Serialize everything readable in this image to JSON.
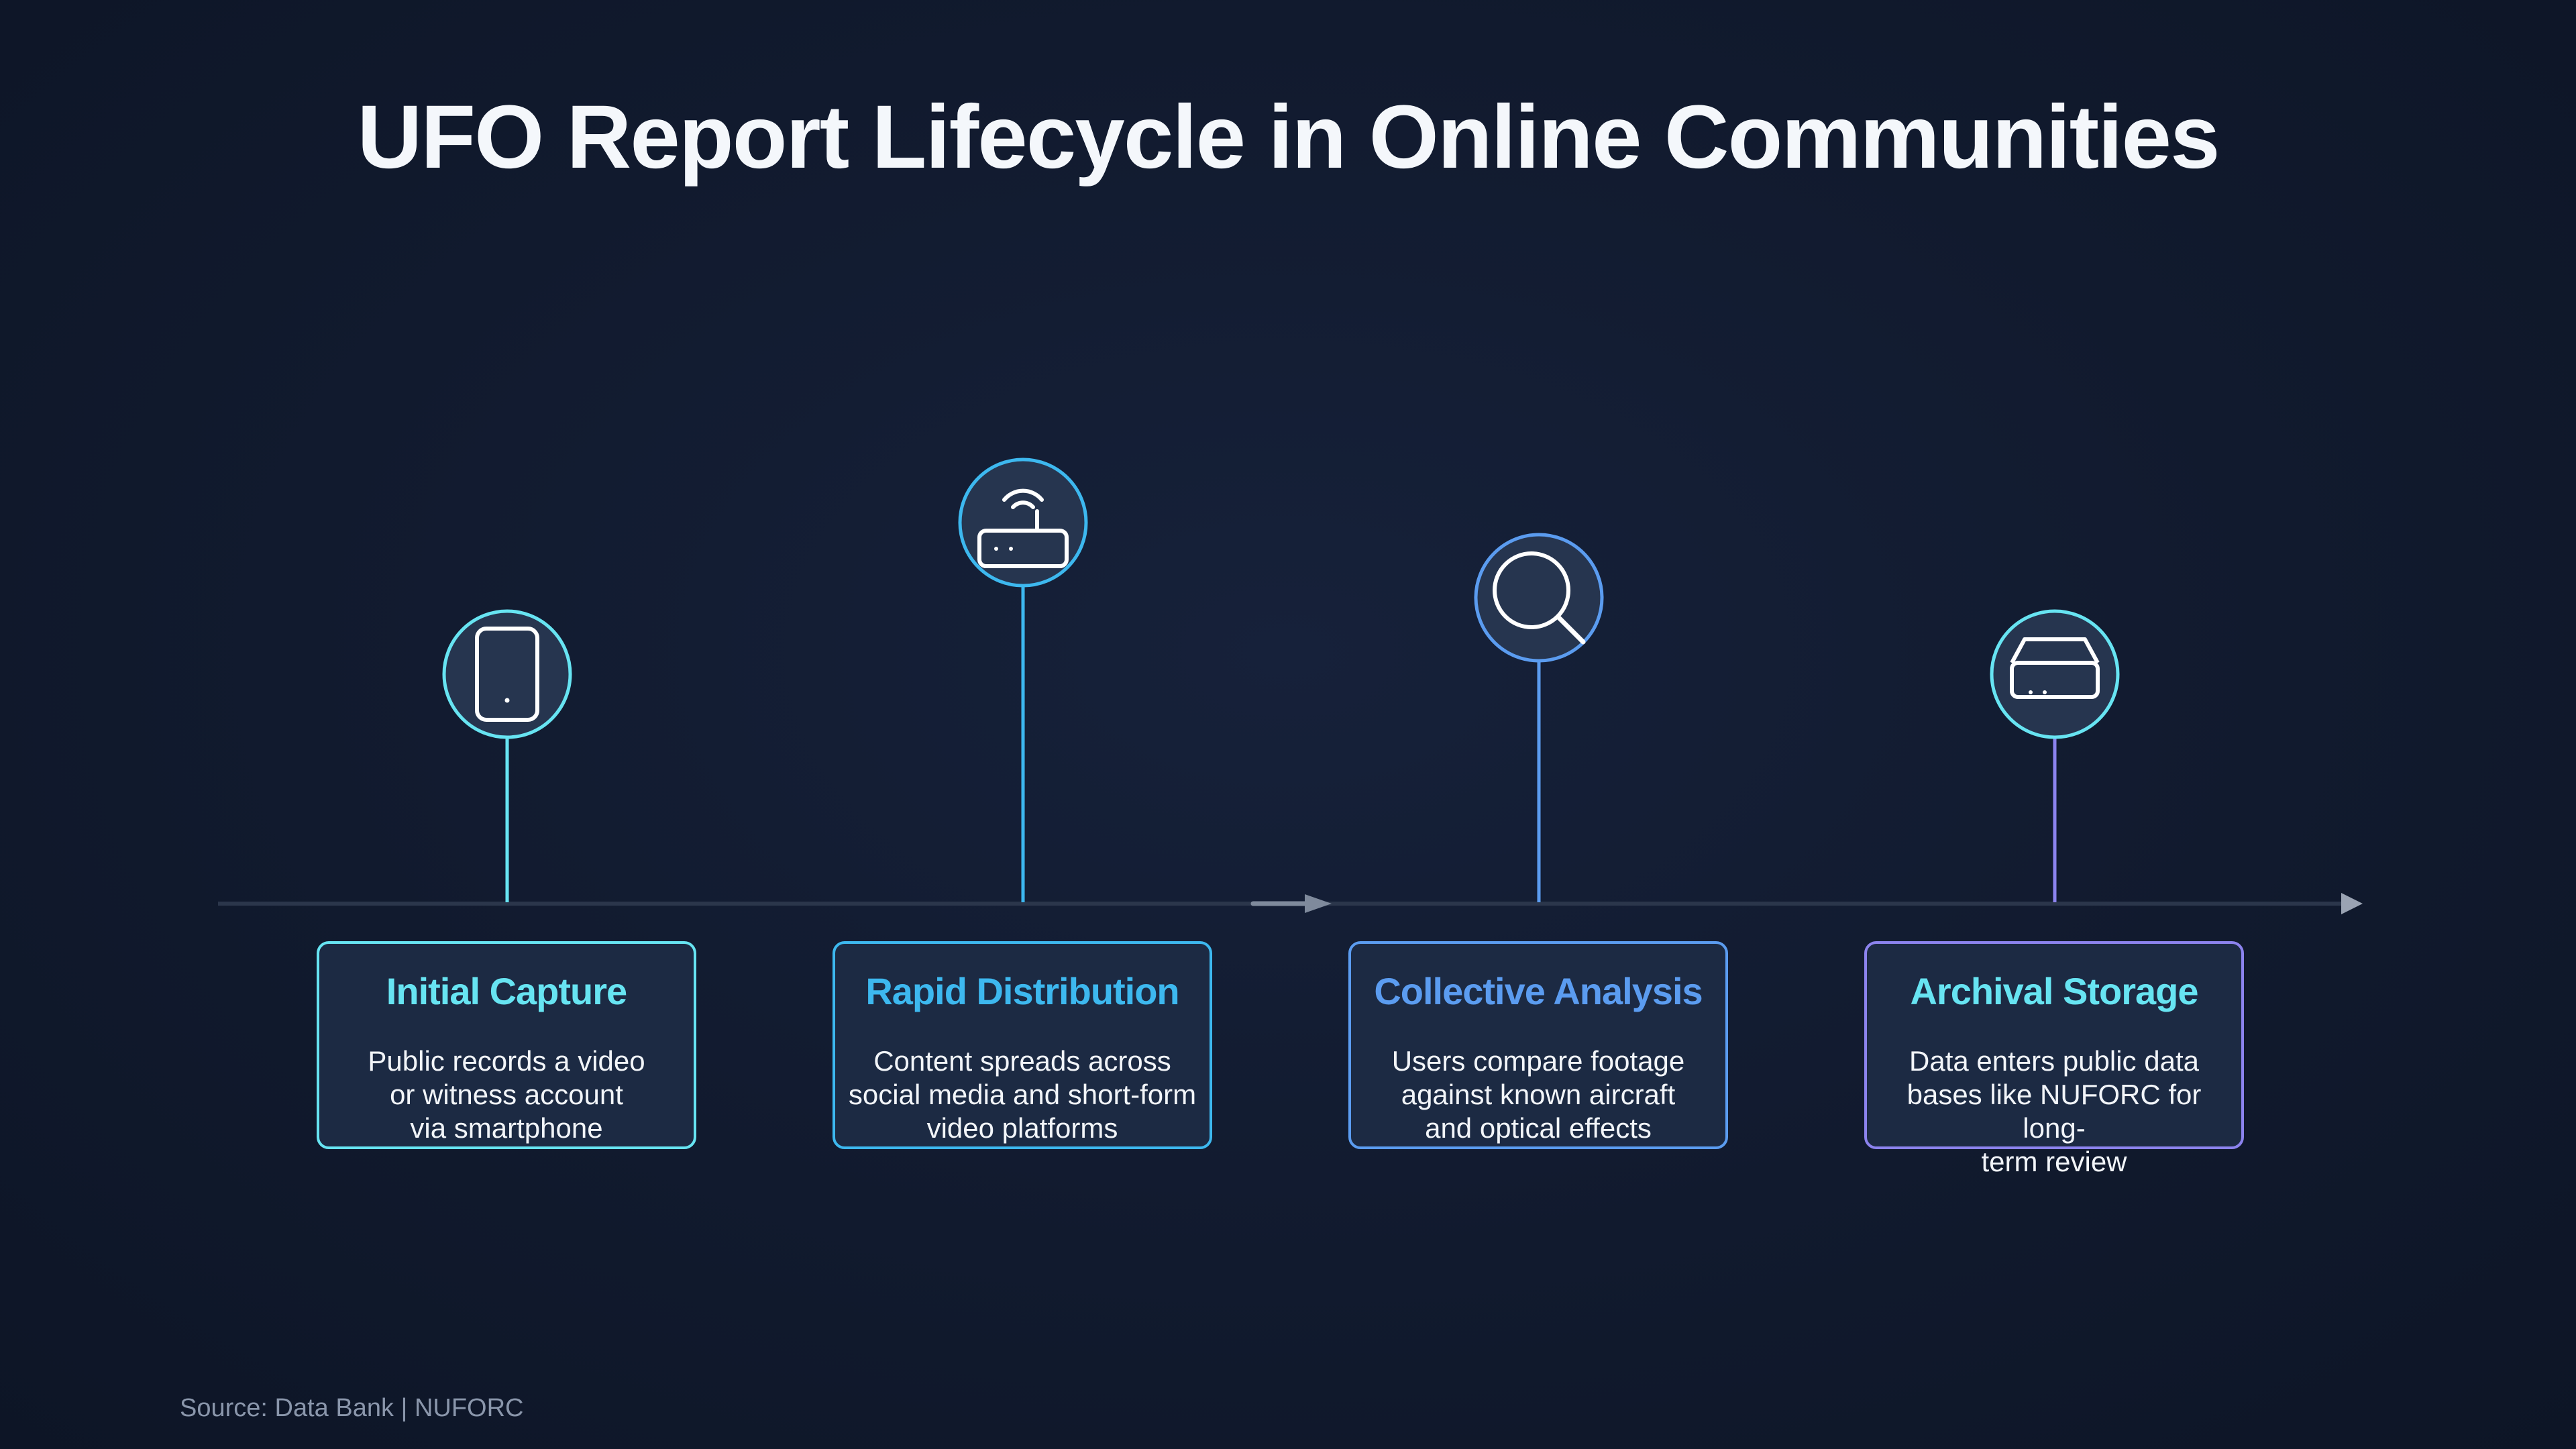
{
  "title": "UFO Report Lifecycle in Online Communities",
  "source": "Source: Data Bank | NUFORC",
  "colors": {
    "background": "#111a2e",
    "card_fill": "#1c2a43",
    "axis": "#2b364b",
    "cyan": "#67e4f2",
    "sky": "#3db8ef",
    "blue": "#5b9cf0",
    "violet": "#8c83ee"
  },
  "stages": [
    {
      "title": "Initial Capture",
      "desc_lines": [
        "Public records a video",
        "or witness account",
        "via smartphone"
      ],
      "icon": "smartphone-icon",
      "accent": "#67e4f2",
      "title_color": "#67e4f2"
    },
    {
      "title": "Rapid Distribution",
      "desc_lines": [
        "Content spreads across",
        "social media and short-form",
        "video platforms"
      ],
      "icon": "router-icon",
      "accent": "#3db8ef",
      "title_color": "#3db8ef"
    },
    {
      "title": "Collective Analysis",
      "desc_lines": [
        "Users compare footage",
        "against known aircraft",
        "and optical effects"
      ],
      "icon": "magnifier-icon",
      "accent": "#5b9cf0",
      "title_color": "#5b9cf0"
    },
    {
      "title": "Archival Storage",
      "desc_lines": [
        "Data enters public data",
        "bases like NUFORC for long-",
        "term review"
      ],
      "icon": "storage-box-icon",
      "accent": "#8c83ee",
      "title_color": "#67e4f2"
    }
  ]
}
